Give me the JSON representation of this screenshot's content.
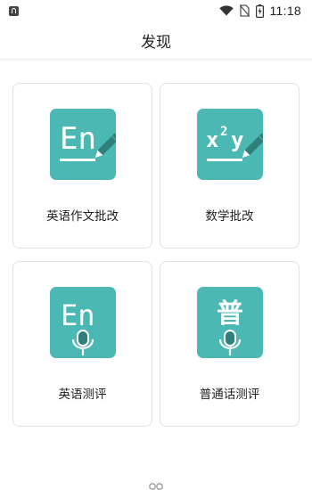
{
  "status_bar": {
    "time": "11:18",
    "icons": [
      "app-icon",
      "wifi-icon",
      "no-sim-icon",
      "battery-charging-icon"
    ]
  },
  "header": {
    "title": "发现"
  },
  "cards": [
    {
      "label": "英语作文批改",
      "icon": "english-writing-icon",
      "icon_text": "En"
    },
    {
      "label": "数学批改",
      "icon": "math-correction-icon",
      "icon_text": "x²y"
    },
    {
      "label": "英语测评",
      "icon": "english-speaking-icon",
      "icon_text": "En"
    },
    {
      "label": "普通话测评",
      "icon": "mandarin-speaking-icon",
      "icon_text": "普"
    }
  ],
  "colors": {
    "accent": "#4cb8b3",
    "pencil_tip": "#ffffff",
    "card_border": "#e2e2e2",
    "text": "#222222"
  }
}
